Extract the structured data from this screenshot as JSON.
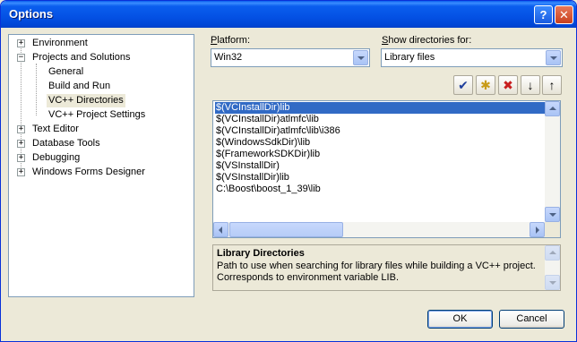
{
  "window": {
    "title": "Options",
    "help_glyph": "?",
    "close_glyph": "✕"
  },
  "tree": {
    "items": [
      {
        "label": "Environment",
        "expander": "+",
        "level": 0
      },
      {
        "label": "Projects and Solutions",
        "expander": "−",
        "level": 0
      },
      {
        "label": "General",
        "level": 1
      },
      {
        "label": "Build and Run",
        "level": 1
      },
      {
        "label": "VC++ Directories",
        "level": 1,
        "selected": true
      },
      {
        "label": "VC++ Project Settings",
        "level": 1
      },
      {
        "label": "Text Editor",
        "expander": "+",
        "level": 0
      },
      {
        "label": "Database Tools",
        "expander": "+",
        "level": 0
      },
      {
        "label": "Debugging",
        "expander": "+",
        "level": 0
      },
      {
        "label": "Windows Forms Designer",
        "expander": "+",
        "level": 0
      }
    ]
  },
  "platform": {
    "label_first": "P",
    "label_rest": "latform:",
    "value": "Win32"
  },
  "show_dirs": {
    "label_first": "S",
    "label_rest": "how directories for:",
    "value": "Library files"
  },
  "toolbar": {
    "check_glyph": "✔",
    "newfolder_glyph": "✱",
    "delete_glyph": "✖",
    "down_glyph": "↓",
    "up_glyph": "↑"
  },
  "directories": [
    "$(VCInstallDir)lib",
    "$(VCInstallDir)atlmfc\\lib",
    "$(VCInstallDir)atlmfc\\lib\\i386",
    "$(WindowsSdkDir)\\lib",
    "$(FrameworkSDKDir)lib",
    "$(VSInstallDir)",
    "$(VSInstallDir)lib",
    "C:\\Boost\\boost_1_39\\lib"
  ],
  "description": {
    "title": "Library Directories",
    "body": "Path to use when searching for library files while building a VC++ project. Corresponds to environment variable LIB."
  },
  "buttons": {
    "ok": "OK",
    "cancel": "Cancel"
  },
  "colors": {
    "selection": "#316AC5",
    "titlebar": "#0451E4",
    "dialog": "#ECE9D8"
  }
}
